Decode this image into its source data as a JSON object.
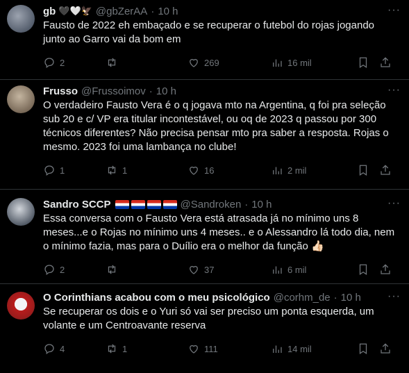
{
  "tweets": [
    {
      "name": "gb",
      "emojis": "🖤🤍🦅",
      "handle": "@gbZerAA",
      "time": "10 h",
      "text": "Fausto de 2022 eh embaçado e se recuperar o futebol do rojas jogando junto ao Garro vai da bom em",
      "replies": "2",
      "retweets": "",
      "likes": "269",
      "views": "16 mil",
      "avatar_color": "#6b7280"
    },
    {
      "name": "Frusso",
      "emojis": "",
      "handle": "@Frussoimov",
      "time": "10 h",
      "text": "O verdadeiro Fausto Vera é o q jogava mto na Argentina, q foi pra seleção sub 20 e c/ VP era titular incontestável, ou oq de 2023 q passou por 300 técnicos diferentes? Não precisa pensar mto pra saber a resposta. Rojas o mesmo. 2023 foi uma lambança no clube!",
      "replies": "1",
      "retweets": "1",
      "likes": "16",
      "views": "2 mil",
      "avatar_color": "#8b7b66"
    },
    {
      "name": "Sandro SCCP",
      "emojis": "",
      "handle": "@Sandroken",
      "time": "10 h",
      "text": "Essa conversa com o Fausto Vera está atrasada já no mínimo uns 8 meses...e o Rojas no mínimo uns 4 meses.. e o Alessandro lá todo dia, nem o mínimo fazia, mas para o Duílio era o melhor da função 👍🏻",
      "replies": "2",
      "retweets": "",
      "likes": "37",
      "views": "6 mil",
      "avatar_color": "#4b5563"
    },
    {
      "name": "O Corinthians acabou com o meu psicológico",
      "emojis": "",
      "handle": "@corhm_de",
      "time": "10 h",
      "text": "Se recuperar os dois e o Yuri só vai ser preciso um ponta esquerda, um volante e um Centroavante reserva",
      "replies": "4",
      "retweets": "1",
      "likes": "111",
      "views": "14 mil",
      "avatar_color": "#b91c1c"
    }
  ],
  "separator": "·",
  "more_glyph": "···"
}
